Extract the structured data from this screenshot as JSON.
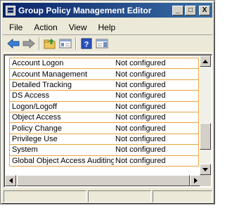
{
  "window": {
    "title": "Group Policy Management Editor",
    "title_buttons": [
      "_",
      "□",
      "X"
    ]
  },
  "menu": {
    "items": [
      "File",
      "Action",
      "View",
      "Help"
    ]
  },
  "toolbar": {
    "icons": [
      "back-arrow-icon",
      "forward-arrow-icon",
      "up-folder-icon",
      "show-hide-tree-icon",
      "help-icon",
      "properties-pane-icon"
    ]
  },
  "list": {
    "rows": [
      {
        "name": "Account Logon",
        "value": "Not configured"
      },
      {
        "name": "Account Management",
        "value": "Not configured"
      },
      {
        "name": "Detailed Tracking",
        "value": "Not configured"
      },
      {
        "name": "DS Access",
        "value": "Not configured"
      },
      {
        "name": "Logon/Logoff",
        "value": "Not configured"
      },
      {
        "name": "Object Access",
        "value": "Not configured"
      },
      {
        "name": "Policy Change",
        "value": "Not configured"
      },
      {
        "name": "Privilege Use",
        "value": "Not configured"
      },
      {
        "name": "System",
        "value": "Not configured"
      },
      {
        "name": "Global Object Access Auditing",
        "value": "Not configured"
      }
    ],
    "highlight_color": "#e8a33a"
  },
  "colors": {
    "titlebar_start": "#0a246a",
    "titlebar_end": "#3a6ea5",
    "window_bg": "#ece9d8"
  }
}
